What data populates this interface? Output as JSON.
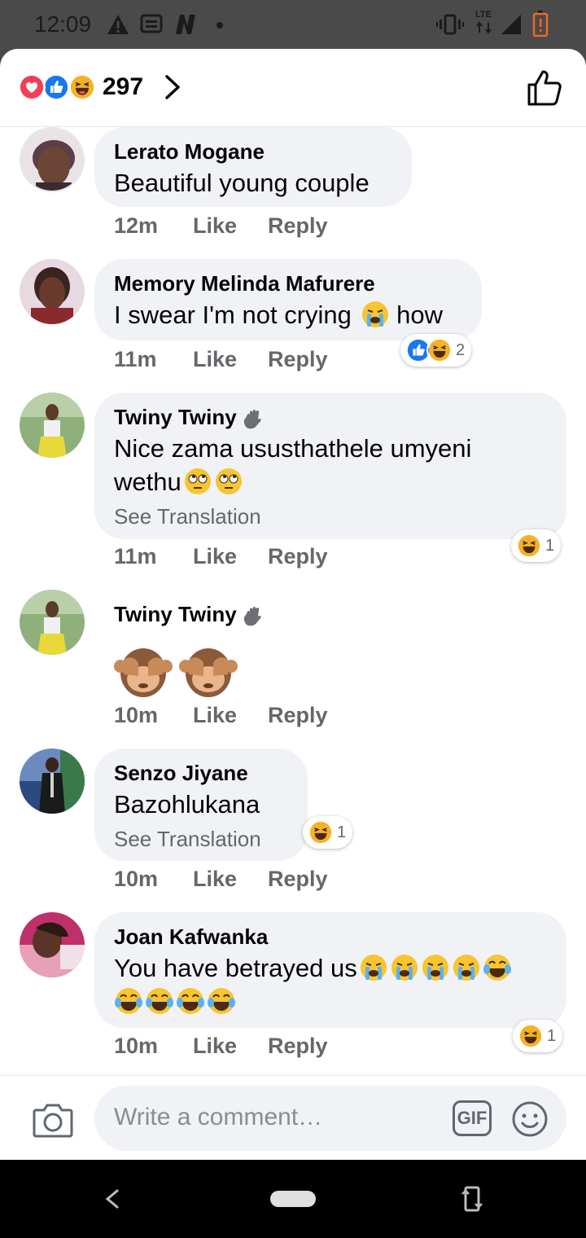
{
  "status_bar": {
    "time": "12:09",
    "network": "LTE"
  },
  "header": {
    "reaction_count": "297",
    "reactions": [
      "love",
      "like",
      "haha"
    ]
  },
  "comments": [
    {
      "author": "Lerato Mogane",
      "text": "Beautiful  young couple",
      "time": "12m",
      "like": "Like",
      "reply": "Reply"
    },
    {
      "author": "Memory Melinda Mafurere",
      "text": "I swear I'm not crying",
      "text_after": "how",
      "time": "11m",
      "like": "Like",
      "reply": "Reply",
      "reactions": {
        "icons": [
          "like",
          "haha"
        ],
        "count": "2"
      }
    },
    {
      "author": "Twiny Twiny",
      "badge": "waving-hand",
      "text_line1": "Nice  zama ususthathele umyeni",
      "text_line2": "wethu",
      "see_translation": "See Translation",
      "time": "11m",
      "like": "Like",
      "reply": "Reply",
      "reactions": {
        "icons": [
          "haha"
        ],
        "count": "1"
      }
    },
    {
      "author": "Twiny Twiny",
      "badge": "waving-hand",
      "emoji_only": [
        "see-no-evil-monkey",
        "see-no-evil-monkey"
      ],
      "time": "10m",
      "like": "Like",
      "reply": "Reply"
    },
    {
      "author": "Senzo Jiyane",
      "text": "Bazohlukana",
      "see_translation": "See Translation",
      "time": "10m",
      "like": "Like",
      "reply": "Reply",
      "reactions": {
        "icons": [
          "haha"
        ],
        "count": "1"
      }
    },
    {
      "author": "Joan Kafwanka",
      "text": "You have betrayed us",
      "time": "10m",
      "like": "Like",
      "reply": "Reply",
      "reactions": {
        "icons": [
          "haha"
        ],
        "count": "1"
      }
    }
  ],
  "composer": {
    "placeholder": "Write a comment…",
    "gif_label": "GIF"
  },
  "colors": {
    "like_blue": "#1877f2",
    "love_red": "#f33e58",
    "haha_yellow": "#f7b125",
    "bubble_gray": "#f0f2f5",
    "meta_gray": "#65676b"
  }
}
